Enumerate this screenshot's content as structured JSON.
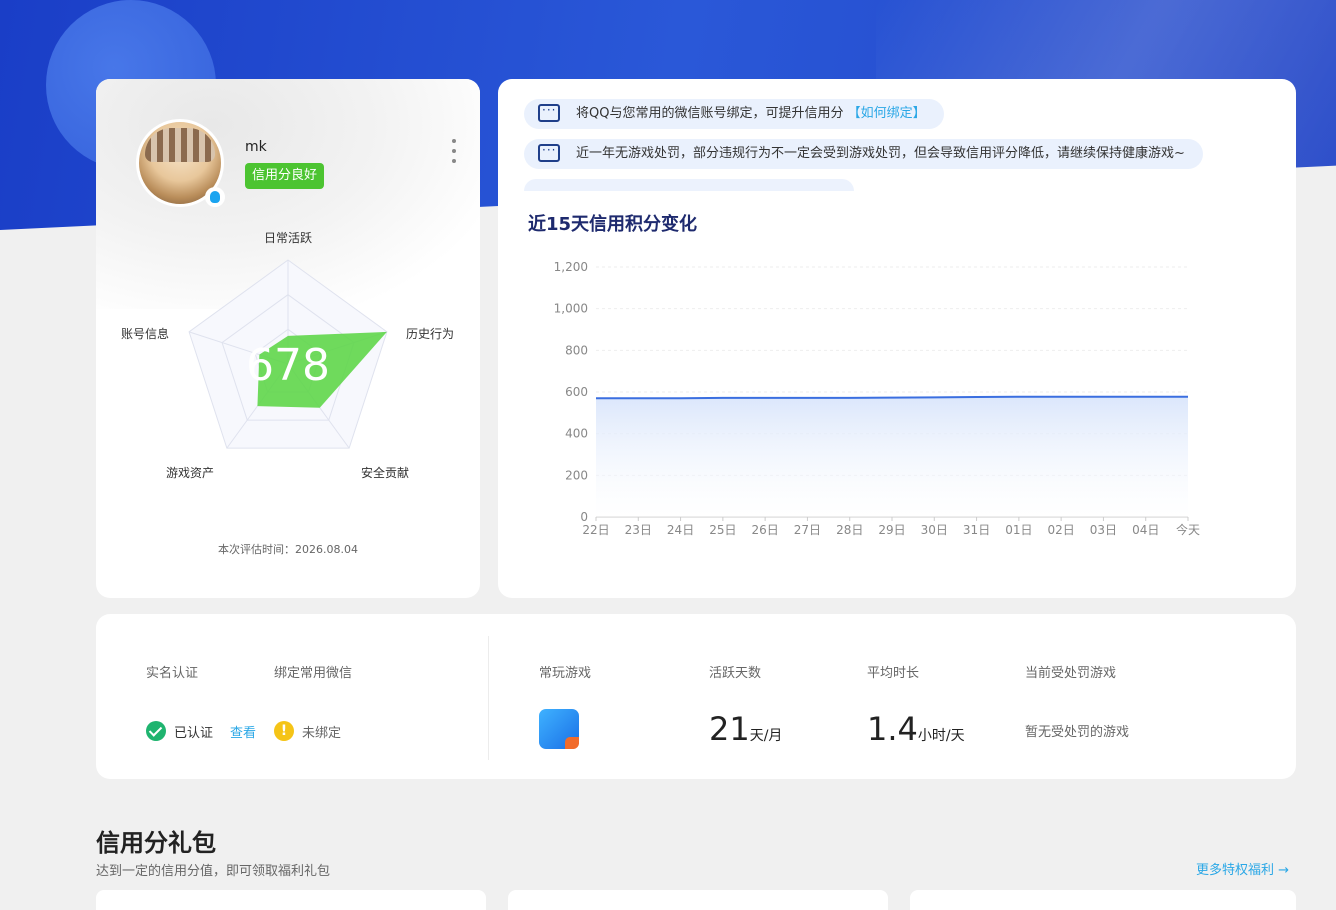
{
  "profile": {
    "username": "mk",
    "credit_tag": "信用分良好",
    "score": "678",
    "radar_labels": [
      "日常活跃",
      "历史行为",
      "安全贡献",
      "游戏资产",
      "账号信息"
    ],
    "evaluation_time": "本次评估时间：2026.08.04"
  },
  "tips": [
    {
      "text": "将QQ与您常用的微信账号绑定，可提升信用分",
      "link": "【如何绑定】"
    },
    {
      "text": "近一年无游戏处罚，部分违规行为不一定会受到游戏处罚，但会导致信用评分降低，请继续保持健康游戏~",
      "link": ""
    }
  ],
  "chart_data": {
    "type": "area",
    "title": "近15天信用积分变化",
    "categories": [
      "22日",
      "23日",
      "24日",
      "25日",
      "26日",
      "27日",
      "28日",
      "29日",
      "30日",
      "31日",
      "01日",
      "02日",
      "03日",
      "04日",
      "今天"
    ],
    "y_ticks": [
      "0",
      "200",
      "400",
      "600",
      "800",
      "1,000",
      "1,200"
    ],
    "series": [
      {
        "values": [
          570,
          570,
          570,
          572,
          572,
          572,
          572,
          573,
          574,
          576,
          577,
          577,
          577,
          577,
          577
        ]
      }
    ],
    "ylim": [
      0,
      1200
    ],
    "grid": true,
    "color": "#3b6fe0"
  },
  "stats": {
    "realname_label": "实名认证",
    "realname_status": "已认证",
    "realname_link": "查看",
    "wechat_label": "绑定常用微信",
    "wechat_status": "未绑定",
    "wechat_warn_icon": "!",
    "games_label": "常玩游戏",
    "active_days_label": "活跃天数",
    "active_days_value": "21",
    "active_days_unit": "天/月",
    "avg_time_label": "平均时长",
    "avg_time_value": "1.4",
    "avg_time_unit": "小时/天",
    "punish_label": "当前受处罚游戏",
    "punish_value": "暂无受处罚的游戏"
  },
  "gift": {
    "title": "信用分礼包",
    "subtitle": "达到一定的信用分值，即可领取福利礼包",
    "more": "更多特权福利 →"
  }
}
